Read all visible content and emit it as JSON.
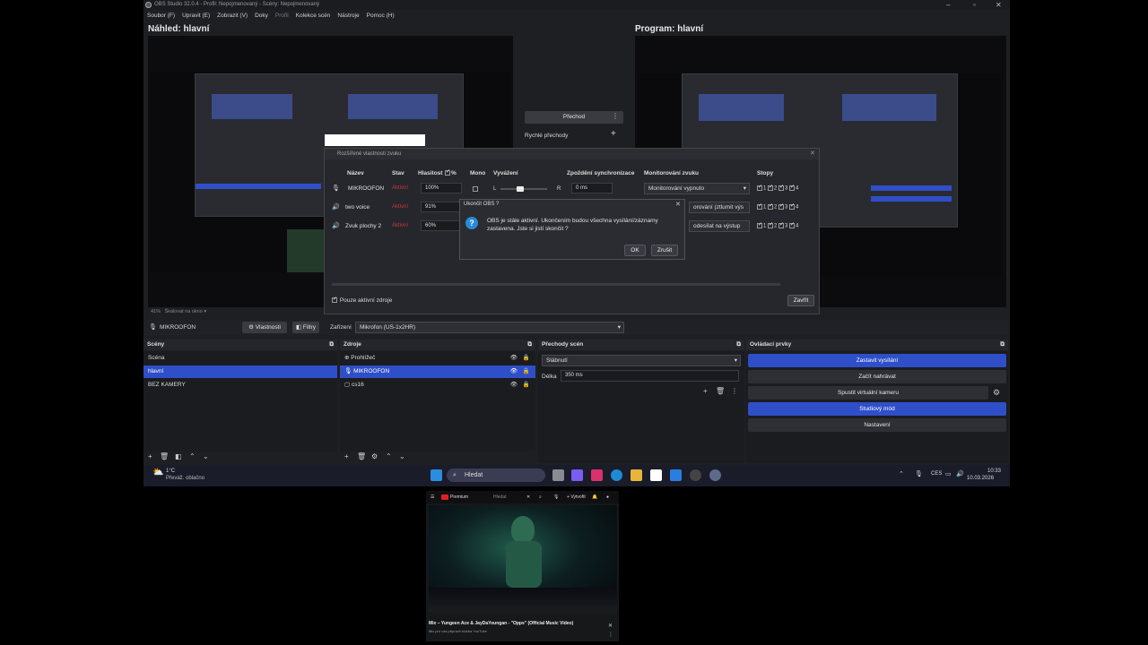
{
  "window": {
    "title": "OBS Studio 32.0.4 - Profil: Nepojmenovaný - Scény: Nepojmenovaný"
  },
  "menu": [
    "Soubor (F)",
    "Upravit (E)",
    "Zobrazit (V)",
    "Doky",
    "Profil",
    "Kolekce scén",
    "Nástroje",
    "Pomoc (H)"
  ],
  "preview": {
    "left_title": "Náhled: hlavní",
    "right_title": "Program: hlavní"
  },
  "transition_panel": {
    "button": "Přechod",
    "quick_label": "Rychlé přechody"
  },
  "mixer_dialog": {
    "title": "Rozšířené vlastnosti zvuku",
    "columns": [
      "Název",
      "Stav",
      "Hlasitost",
      "%",
      "Mono",
      "Vyvážení",
      "Zpoždění synchronizace",
      "Monitorování zvuku",
      "Stopy"
    ],
    "rows": [
      {
        "name": "MIKROOFON",
        "status": "Aktivní",
        "volume": "100%",
        "sync": "0 ms",
        "monitor": "Monitorování vypnuto",
        "balance_left": "L",
        "balance_right": "R"
      },
      {
        "name": "two voice",
        "status": "Aktivní",
        "volume": "91%",
        "monitor": "orování (ztlumit výs"
      },
      {
        "name": "Zvuk plochy 2",
        "status": "Aktivní",
        "volume": "60%",
        "monitor": "odesílat na výstup"
      }
    ],
    "tracks": [
      "1",
      "2",
      "3",
      "4"
    ],
    "only_active": "Pouze aktivní zdroje",
    "close": "Zavřít"
  },
  "quit_dialog": {
    "title": "Ukončit OBS ?",
    "message_line1": "OBS je stále aktivní. Ukončením budou všechna vysílání/záznamy",
    "message_line2": "zastavena. Jste si jistí skončit ?",
    "ok": "OK",
    "cancel": "Zrušit"
  },
  "preview_footer": {
    "zoom": "41%",
    "scale_label": "Škálovat na okno"
  },
  "source_bar": {
    "source_name": "MIKROOFON",
    "properties": "Vlastnosti",
    "filters": "Filtry",
    "device_label": "Zařízení",
    "device_value": "Mikrofon (US-1x2HR)"
  },
  "scenes": {
    "title": "Scény",
    "items": [
      "Scéna",
      "hlavní",
      "BEZ KAMERY"
    ],
    "selected": 1
  },
  "sources": {
    "title": "Zdroje",
    "items": [
      "Prohlížeč",
      "MIKROOFON",
      "cs16"
    ],
    "selected": 1
  },
  "transitions": {
    "title": "Přechody scén",
    "type": "Slábnutí",
    "duration_label": "Délka",
    "duration_value": "350 ms"
  },
  "controls": {
    "title": "Ovládací prvky",
    "buttons": [
      "Zastavit vysílání",
      "Začít nahrávat",
      "Spustit virtuální kameru",
      "Studiový mód",
      "Nastavení"
    ]
  },
  "taskbar": {
    "weather_temp": "1°C",
    "weather_desc": "Převáž. oblačno",
    "search": "Hledat",
    "lang": "CES",
    "time": "10:33",
    "date": "10.03.2026"
  },
  "mini_player": {
    "brand": "Premium",
    "search_placeholder": "Hledat",
    "create": "Vytvořit",
    "video_title": "Mix – Yungeen Ace & JayDaYoungan - \"Opps\" (Official Music Video)",
    "video_sub": "Mix pro vás připravil služba YouTube"
  }
}
